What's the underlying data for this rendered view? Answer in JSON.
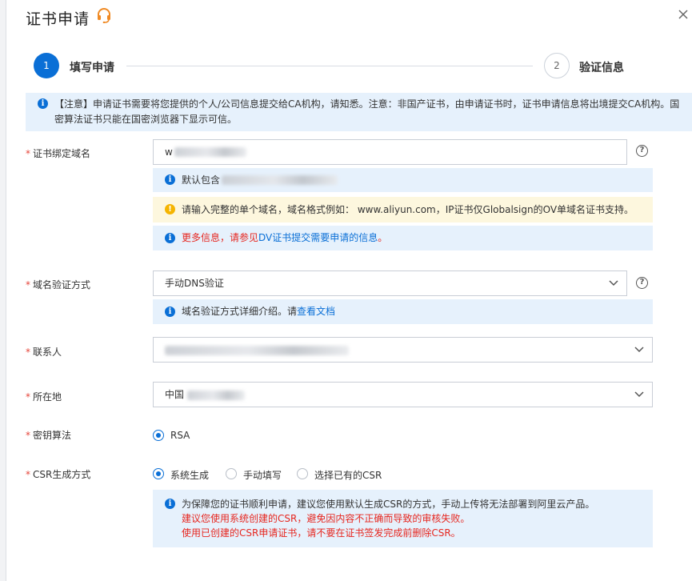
{
  "dialog": {
    "title": "证书申请"
  },
  "steps": [
    {
      "number": "1",
      "label": "填写申请"
    },
    {
      "number": "2",
      "label": "验证信息"
    }
  ],
  "notice": {
    "text": "【注意】申请证书需要将您提供的个人/公司信息提交给CA机构，请知悉。注意：非国产证书，由申请证书时，证书申请信息将出境提交CA机构。国密算法证书只能在国密浏览器下显示可信。"
  },
  "form": {
    "domain": {
      "label": "证书绑定域名",
      "value_prefix": "w",
      "default_tip_prefix": "默认包含",
      "format_tip": "请输入完整的单个域名，域名格式例如： www.aliyun.com，IP证书仅Globalsign的OV单域名证书支持。",
      "more_info_red": "更多信息，请参见",
      "more_info_link": "DV证书提交需要申请的信息",
      "more_info_end": "。"
    },
    "verify_method": {
      "label": "域名验证方式",
      "value": "手动DNS验证",
      "tip_text": "域名验证方式详细介绍。请",
      "tip_link": "查看文档"
    },
    "contact": {
      "label": "联系人"
    },
    "location": {
      "label": "所在地",
      "value_prefix": "中国"
    },
    "key_algorithm": {
      "label": "密钥算法",
      "option": "RSA"
    },
    "csr": {
      "label": "CSR生成方式",
      "options": [
        "系统生成",
        "手动填写",
        "选择已有的CSR"
      ],
      "tip_line1": "为保障您的证书顺利申请，建议您使用默认生成CSR的方式，手动上传将无法部署到阿里云产品。",
      "tip_line2": "建议您使用系统创建的CSR，避免因内容不正确而导致的审核失败。",
      "tip_line3": "使用已创建的CSR申请证书，请不要在证书签发完成前删除CSR。"
    }
  },
  "required_mark": "*",
  "colors": {
    "primary": "#0a6fd6",
    "required": "#e6453a",
    "info_bg": "#e6f1fc",
    "warning_bg": "#fdf7de",
    "error_text": "#e6261f"
  }
}
